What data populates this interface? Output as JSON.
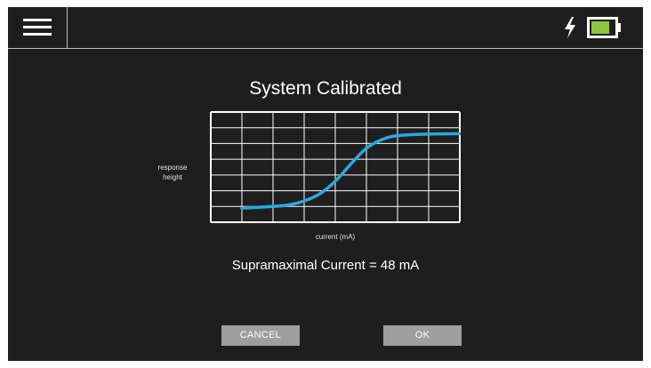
{
  "header": {
    "menu_icon": "hamburger-menu-icon",
    "charging_icon": "lightning-bolt-icon",
    "battery_icon": "battery-icon",
    "battery_level": 0.8,
    "battery_color": "#8cc63f"
  },
  "dialog": {
    "title": "System Calibrated",
    "result_label": "Supramaximal Current = ",
    "result_value": "48 mA",
    "cancel_label": "CANCEL",
    "ok_label": "OK"
  },
  "colors": {
    "background": "#1e1e1e",
    "curve": "#29a8e0",
    "grid": "#ffffff",
    "button": "#9e9e9e"
  },
  "chart_data": {
    "type": "line",
    "title": "",
    "xlabel": "current (mA)",
    "ylabel": "response height",
    "grid": true,
    "grid_cols": 8,
    "grid_rows": 7,
    "xlim": [
      0,
      8
    ],
    "ylim": [
      0,
      7
    ],
    "series": [
      {
        "x": [
          1.0,
          2.0,
          2.5,
          3.0,
          3.5,
          4.0,
          4.5,
          5.0,
          5.5,
          6.0,
          7.0,
          8.0
        ],
        "y": [
          0.9,
          1.0,
          1.1,
          1.35,
          1.8,
          2.6,
          3.7,
          4.7,
          5.25,
          5.5,
          5.6,
          5.62
        ]
      }
    ]
  }
}
